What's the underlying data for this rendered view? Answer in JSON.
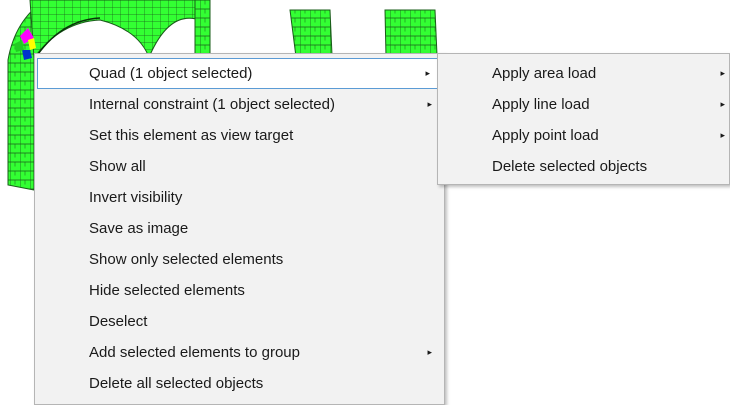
{
  "context_menu": {
    "items": [
      {
        "label": "Quad (1 object selected)",
        "has_submenu": true,
        "selected": true
      },
      {
        "label": "Internal constraint (1 object selected)",
        "has_submenu": true
      },
      {
        "label": "Set this element as view target",
        "has_submenu": false
      },
      {
        "label": "Show all",
        "has_submenu": false
      },
      {
        "label": "Invert visibility",
        "has_submenu": false
      },
      {
        "label": "Save as image",
        "has_submenu": false
      },
      {
        "label": "Show only selected elements",
        "has_submenu": false
      },
      {
        "label": "Hide selected elements",
        "has_submenu": false
      },
      {
        "label": "Deselect",
        "has_submenu": false
      },
      {
        "label": "Add selected elements to group",
        "has_submenu": true
      },
      {
        "label": "Delete all selected objects",
        "has_submenu": false
      }
    ]
  },
  "submenu": {
    "items": [
      {
        "label": "Apply area load",
        "has_submenu": true
      },
      {
        "label": "Apply line load",
        "has_submenu": true
      },
      {
        "label": "Apply point load",
        "has_submenu": true
      },
      {
        "label": "Delete selected objects",
        "has_submenu": false
      }
    ]
  },
  "colors": {
    "mesh_fill": "#33ff33",
    "mesh_lines": "#1a5c1a",
    "menu_bg": "#f2f2f2",
    "highlight_border": "#5b9bd5",
    "node_magenta": "#ff00ff",
    "node_yellow": "#ffff00",
    "node_blue": "#0033cc"
  },
  "icons": {
    "submenu_arrow": "▸"
  }
}
